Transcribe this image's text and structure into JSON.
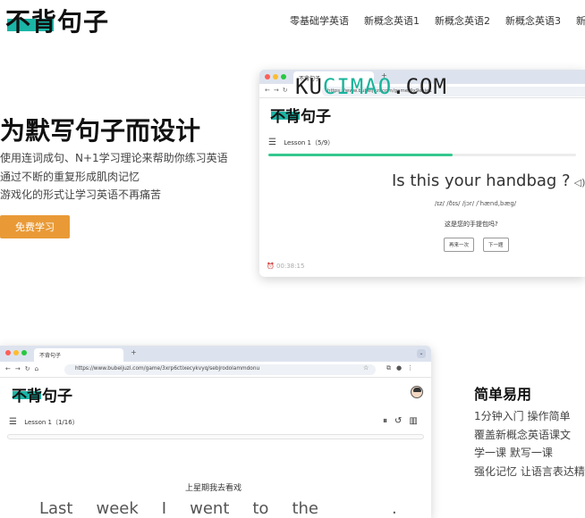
{
  "brand": {
    "logo_text": "不背句子"
  },
  "nav": {
    "items": [
      "零基础学英语",
      "新概念英语1",
      "新概念英语2",
      "新概念英语3",
      "新概念"
    ]
  },
  "hero": {
    "title": "为默写句子而设计",
    "lines": [
      "使用连词成句、N+1学习理论来帮助你练习英语",
      "通过不断的重复形成肌肉记忆",
      "游戏化的形式让学习英语不再痛苦"
    ],
    "cta_label": "免费学习"
  },
  "watermark": {
    "part1": "KU",
    "part2": "CIMAO",
    "part3": ".COM"
  },
  "preview1": {
    "tab_title": "不背句子",
    "url": "https://www.bubeijuzi.com/game/9x9esie1",
    "lesson": "Lesson 1（5/9）",
    "progress": 0.6,
    "sentence": "Is this your handbag ?",
    "phonetic": "/ɪz/ /ðɪs/ /jɔr/ /ˈhænd,bæg/",
    "translation": "这是您的手提包吗?",
    "btn_repeat": "再来一次",
    "btn_next": "下一题",
    "timer": "00:38:15"
  },
  "preview2": {
    "tab_title": "不背句子",
    "url": "https://www.bubeijuzi.com/game/3xrp6ctixecykvyq/sebjrodolammdonu",
    "lesson": "Lesson 1（1/16）",
    "translation": "上星期我去看戏",
    "words": [
      "Last",
      "week",
      "I",
      "went",
      "to",
      "the"
    ],
    "blank": "."
  },
  "features": {
    "title": "简单易用",
    "lines": [
      "1分钟入门 操作简单",
      "覆盖新概念英语课文",
      "学一课 默写一课",
      "强化记忆 让语言表达精准"
    ]
  },
  "colors": {
    "accent": "#1bb5a6",
    "cta": "#e99a37",
    "progress": "#35c88f"
  }
}
